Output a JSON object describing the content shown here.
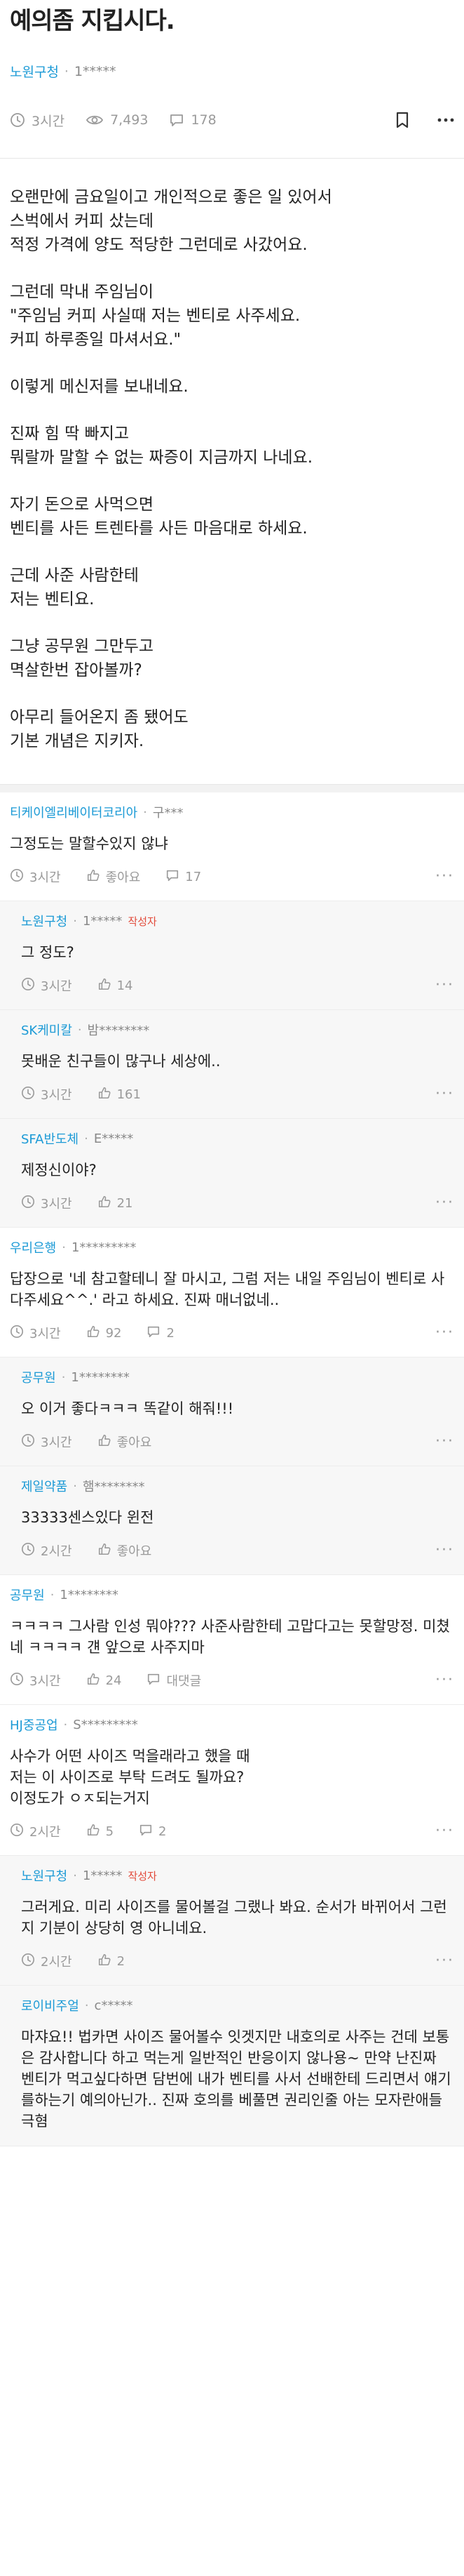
{
  "post": {
    "title": "예의좀 지킵시다.",
    "author": {
      "company": "노원구청",
      "separator": "·",
      "nickname": "1*****"
    },
    "meta": {
      "time": "3시간",
      "views": "7,493",
      "comments": "178"
    },
    "body": [
      "오랜만에 금요일이고 개인적으로 좋은 일 있어서\n스벅에서 커피 샀는데\n적정 가격에 양도 적당한 그런데로 사갔어요.",
      "그런데 막내 주임님이\n\"주임님 커피 사실때 저는 벤티로 사주세요.\n커피 하루종일 마셔서요.\"",
      "이렇게 메신저를 보내네요.",
      "진짜 힘 딱 빠지고\n뭐랄까 말할 수 없는 짜증이 지금까지 나네요.",
      "자기 돈으로 사먹으면\n벤티를 사든 트렌타를 사든 마음대로 하세요.",
      "근데 사준 사람한테\n저는 벤티요.",
      "그냥 공무원 그만두고\n멱살한번 잡아볼까?",
      "아무리 들어온지 좀 됐어도\n기본 개념은 지키자."
    ]
  },
  "comments": [
    {
      "company": "티케이엘리베이터코리아",
      "sep": "·",
      "nick": "구***",
      "badge": "",
      "text": "그정도는 말할수있지 않냐",
      "time": "3시간",
      "likes": "좋아요",
      "replies": "17",
      "reply": false
    },
    {
      "company": "노원구청",
      "sep": "·",
      "nick": "1*****",
      "badge": "작성자",
      "text": "그 정도?",
      "time": "3시간",
      "likes": "14",
      "replies": "",
      "reply": true
    },
    {
      "company": "SK케미칼",
      "sep": "·",
      "nick": "밤********",
      "badge": "",
      "text": "못배운 친구들이 많구나 세상에..",
      "time": "3시간",
      "likes": "161",
      "replies": "",
      "reply": true
    },
    {
      "company": "SFA반도체",
      "sep": "·",
      "nick": "E*****",
      "badge": "",
      "text": "제정신이야?",
      "time": "3시간",
      "likes": "21",
      "replies": "",
      "reply": true
    },
    {
      "company": "우리은행",
      "sep": "·",
      "nick": "1*********",
      "badge": "",
      "text": "답장으로 '네 참고할테니 잘 마시고, 그럼 저는 내일 주임님이 벤티로 사다주세요^^.' 라고 하세요. 진짜 매너없네..",
      "time": "3시간",
      "likes": "92",
      "replies": "2",
      "reply": false
    },
    {
      "company": "공무원",
      "sep": "·",
      "nick": "1********",
      "badge": "",
      "text": "오 이거 좋다ㅋㅋㅋ 똑같이 해줘!!!",
      "time": "3시간",
      "likes": "좋아요",
      "replies": "",
      "reply": true
    },
    {
      "company": "제일약품",
      "sep": "·",
      "nick": "햄********",
      "badge": "",
      "text": "33333센스있다 윈전",
      "time": "2시간",
      "likes": "좋아요",
      "replies": "",
      "reply": true
    },
    {
      "company": "공무원",
      "sep": "·",
      "nick": "1********",
      "badge": "",
      "text": "ㅋㅋㅋㅋ 그사람 인성 뭐야??? 사준사람한테 고맙다고는 못할망정. 미쳤네 ㅋㅋㅋㅋ 걘 앞으로 사주지마",
      "time": "3시간",
      "likes": "24",
      "replies": "대댓글",
      "reply": false
    },
    {
      "company": "HJ중공업",
      "sep": "·",
      "nick": "S*********",
      "badge": "",
      "text": "사수가 어떤 사이즈 먹을래라고 했을 때\n저는 이 사이즈로 부탁 드려도 될까요?\n이정도가 ㅇㅈ되는거지",
      "time": "2시간",
      "likes": "5",
      "replies": "2",
      "reply": false
    },
    {
      "company": "노원구청",
      "sep": "·",
      "nick": "1*****",
      "badge": "작성자",
      "text": "그러게요. 미리 사이즈를 물어볼걸 그랬나 봐요. 순서가 바뀌어서 그런지 기분이 상당히 영 아니네요.",
      "time": "2시간",
      "likes": "2",
      "replies": "",
      "reply": true
    },
    {
      "company": "로이비주얼",
      "sep": "·",
      "nick": "c*****",
      "badge": "",
      "text": "마쟈요!! 법카면 사이즈 물어볼수 잇겟지만 내호의로 사주는 건데 보통은 감사합니다 하고 먹는게 일반적인 반응이지 않나용~ 만약 난진짜 벤티가 먹고싶다하면 담번에 내가 벤티를 사서 선배한테 드리면서 얘기를하는기 예의아닌가.. 진짜 호의를 베풀면 권리인줄 아는 모자란애들 극혐",
      "time": "",
      "likes": "",
      "replies": "",
      "reply": true
    }
  ],
  "icons": {
    "clock": "clock-icon",
    "eye": "eye-icon",
    "comment": "comment-icon",
    "bookmark": "bookmark-icon",
    "more": "more-icon",
    "like": "thumbs-up-icon"
  },
  "colors": {
    "company": "#1b9ad6",
    "author_badge": "#e24b3b",
    "meta": "#9a9a9a"
  }
}
